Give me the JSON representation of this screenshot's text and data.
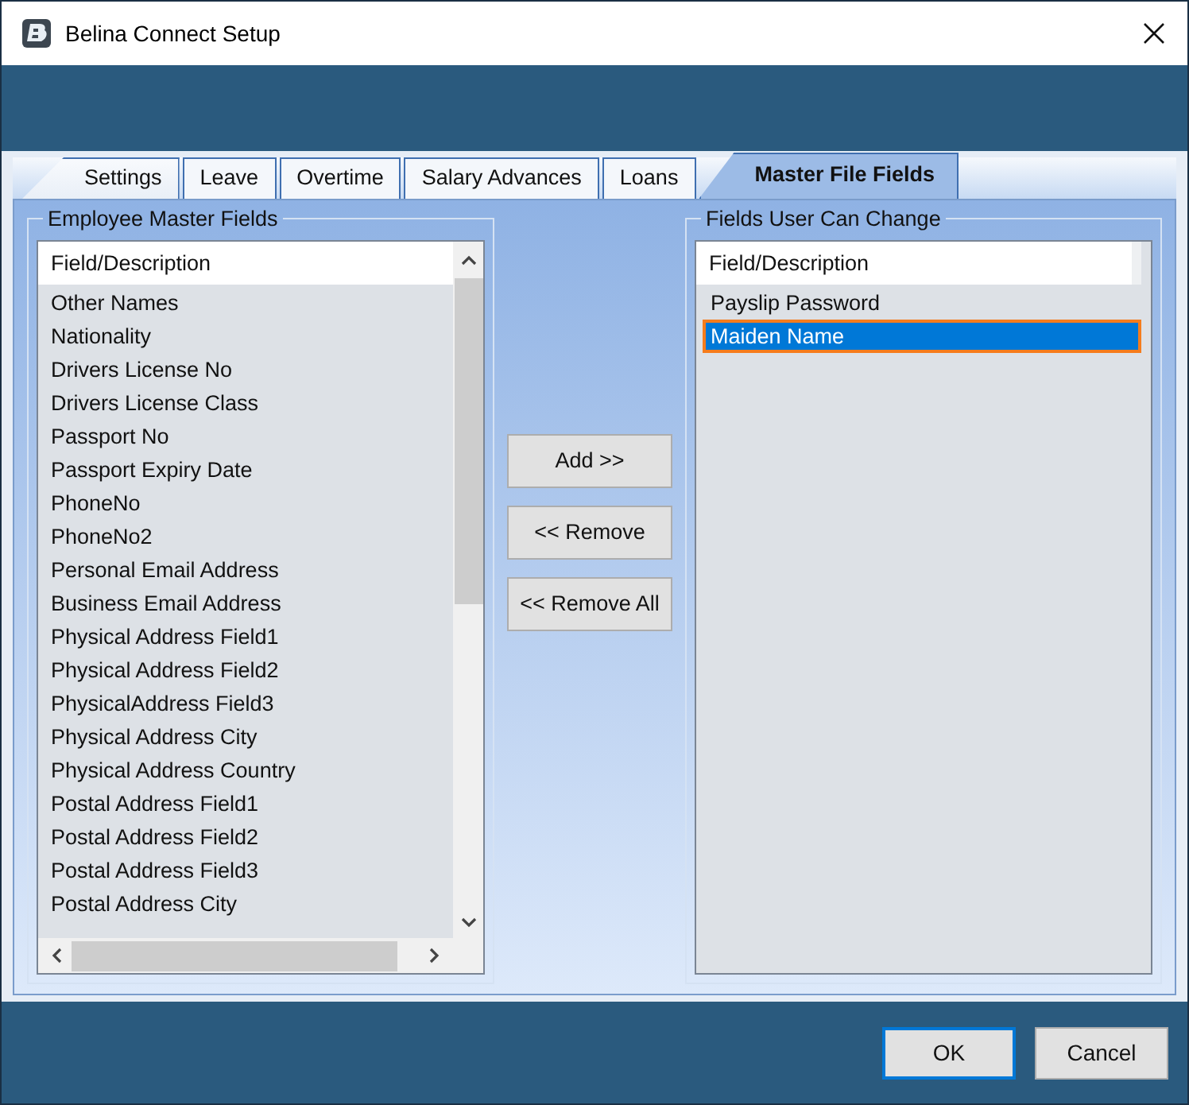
{
  "window": {
    "title": "Belina Connect Setup"
  },
  "tabs": [
    {
      "label": "Settings",
      "selected": false
    },
    {
      "label": "Leave",
      "selected": false
    },
    {
      "label": "Overtime",
      "selected": false
    },
    {
      "label": "Salary Advances",
      "selected": false
    },
    {
      "label": "Loans",
      "selected": false
    },
    {
      "label": "Master File Fields",
      "selected": true
    }
  ],
  "employee_master_fields": {
    "title": "Employee Master Fields",
    "column": "Field/Description",
    "rows": [
      {
        "label": "Other Names",
        "selected": false
      },
      {
        "label": "Nationality",
        "selected": false
      },
      {
        "label": "Drivers License No",
        "selected": false
      },
      {
        "label": "Drivers License Class",
        "selected": false
      },
      {
        "label": "Passport No",
        "selected": false
      },
      {
        "label": "Passport Expiry Date",
        "selected": false
      },
      {
        "label": "PhoneNo",
        "selected": false
      },
      {
        "label": "PhoneNo2",
        "selected": false
      },
      {
        "label": "Personal Email Address",
        "selected": false
      },
      {
        "label": "Business Email Address",
        "selected": false
      },
      {
        "label": "Physical Address Field1",
        "selected": false
      },
      {
        "label": "Physical Address Field2",
        "selected": false
      },
      {
        "label": "PhysicalAddress Field3",
        "selected": false
      },
      {
        "label": "Physical Address City",
        "selected": false
      },
      {
        "label": "Physical Address Country",
        "selected": false
      },
      {
        "label": "Postal Address Field1",
        "selected": false
      },
      {
        "label": "Postal Address Field2",
        "selected": false
      },
      {
        "label": "Postal Address Field3",
        "selected": false
      },
      {
        "label": "Postal Address City",
        "selected": false
      }
    ]
  },
  "transfer_buttons": [
    "Add >>",
    "<< Remove",
    "<< Remove All"
  ],
  "fields_user_can_change": {
    "title": "Fields User Can Change",
    "column": "Field/Description",
    "rows": [
      {
        "label": "Payslip Password",
        "selected": false
      },
      {
        "label": "Maiden Name",
        "selected": true
      }
    ]
  },
  "buttons": [
    {
      "label": "OK",
      "default": true
    },
    {
      "label": "Cancel",
      "default": false
    }
  ]
}
